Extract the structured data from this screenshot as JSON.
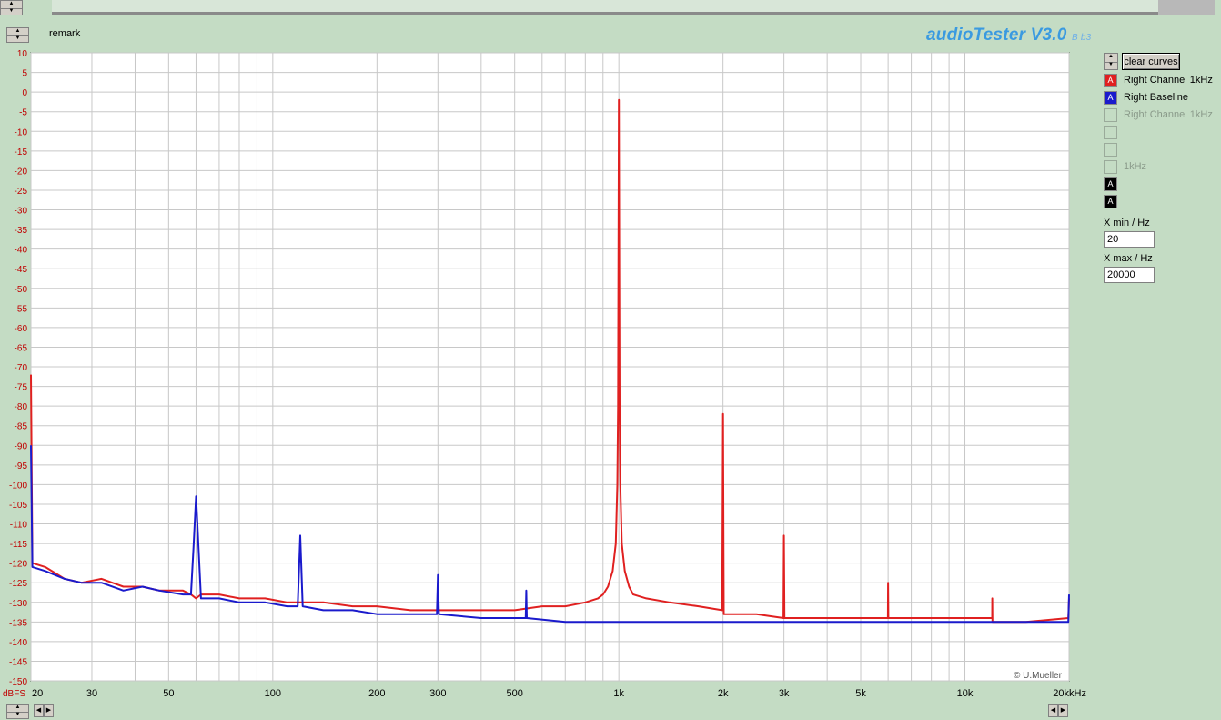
{
  "app": {
    "title": "audioTester V3.0",
    "version": "B b3",
    "remark_label": "remark",
    "copyright": "© U.Mueller"
  },
  "controls": {
    "clear_curves_label": "clear curves",
    "xmin_label": "X min / Hz",
    "xmin_value": "20",
    "xmax_label": "X max / Hz",
    "xmax_value": "20000"
  },
  "legend": [
    {
      "label": "Right Channel 1kHz",
      "marker": "A",
      "color": "#e02020",
      "active": true
    },
    {
      "label": "Right Baseline",
      "marker": "A",
      "color": "#1a1acc",
      "active": true
    },
    {
      "label": "Right Channel 1kHz",
      "marker": "",
      "color": "",
      "active": false
    },
    {
      "label": "",
      "marker": "",
      "color": "",
      "active": false
    },
    {
      "label": "",
      "marker": "",
      "color": "",
      "active": false
    },
    {
      "label": "1kHz",
      "marker": "",
      "color": "",
      "active": false
    },
    {
      "label": "",
      "marker": "A",
      "color": "#000000",
      "active": true
    },
    {
      "label": "",
      "marker": "A",
      "color": "#000000",
      "active": true
    }
  ],
  "chart_data": {
    "type": "line",
    "xscale": "log",
    "xlim": [
      20,
      20000
    ],
    "ylim": [
      -150,
      10
    ],
    "ylabel": "dBFS",
    "xunit": "kHz",
    "grid": true,
    "y_ticks": [
      10,
      5,
      0,
      -5,
      -10,
      -15,
      -20,
      -25,
      -30,
      -35,
      -40,
      -45,
      -50,
      -55,
      -60,
      -65,
      -70,
      -75,
      -80,
      -85,
      -90,
      -95,
      -100,
      -105,
      -110,
      -115,
      -120,
      -125,
      -130,
      -135,
      -140,
      -145,
      -150
    ],
    "x_ticks": [
      {
        "v": 20,
        "label": "20"
      },
      {
        "v": 30,
        "label": "30"
      },
      {
        "v": 50,
        "label": "50"
      },
      {
        "v": 100,
        "label": "100"
      },
      {
        "v": 200,
        "label": "200"
      },
      {
        "v": 300,
        "label": "300"
      },
      {
        "v": 500,
        "label": "500"
      },
      {
        "v": 1000,
        "label": "1k"
      },
      {
        "v": 2000,
        "label": "2k"
      },
      {
        "v": 3000,
        "label": "3k"
      },
      {
        "v": 5000,
        "label": "5k"
      },
      {
        "v": 10000,
        "label": "10k"
      },
      {
        "v": 20000,
        "label": "20k"
      }
    ],
    "series": [
      {
        "name": "Right Channel 1kHz",
        "color": "#e02020",
        "points": [
          [
            20,
            -72
          ],
          [
            20.2,
            -120
          ],
          [
            22,
            -121
          ],
          [
            25,
            -124
          ],
          [
            28,
            -125
          ],
          [
            32,
            -124
          ],
          [
            37,
            -126
          ],
          [
            42,
            -126
          ],
          [
            47,
            -127
          ],
          [
            55,
            -127
          ],
          [
            58,
            -128
          ],
          [
            60,
            -129
          ],
          [
            62,
            -128
          ],
          [
            70,
            -128
          ],
          [
            80,
            -129
          ],
          [
            95,
            -129
          ],
          [
            110,
            -130
          ],
          [
            120,
            -130
          ],
          [
            140,
            -130
          ],
          [
            170,
            -131
          ],
          [
            200,
            -131
          ],
          [
            250,
            -132
          ],
          [
            300,
            -132
          ],
          [
            400,
            -132
          ],
          [
            500,
            -132
          ],
          [
            600,
            -131
          ],
          [
            700,
            -131
          ],
          [
            800,
            -130
          ],
          [
            870,
            -129
          ],
          [
            900,
            -128
          ],
          [
            930,
            -126
          ],
          [
            960,
            -122
          ],
          [
            980,
            -115
          ],
          [
            990,
            -100
          ],
          [
            995,
            -80
          ],
          [
            1000,
            -2
          ],
          [
            1005,
            -80
          ],
          [
            1010,
            -100
          ],
          [
            1020,
            -115
          ],
          [
            1040,
            -122
          ],
          [
            1070,
            -126
          ],
          [
            1100,
            -128
          ],
          [
            1200,
            -129
          ],
          [
            1400,
            -130
          ],
          [
            1700,
            -131
          ],
          [
            1990,
            -132
          ],
          [
            2000,
            -82
          ],
          [
            2010,
            -133
          ],
          [
            2500,
            -133
          ],
          [
            2990,
            -134
          ],
          [
            3000,
            -113
          ],
          [
            3010,
            -134
          ],
          [
            4000,
            -134
          ],
          [
            5000,
            -134
          ],
          [
            5990,
            -134
          ],
          [
            6000,
            -125
          ],
          [
            6010,
            -134
          ],
          [
            8000,
            -134
          ],
          [
            10000,
            -134
          ],
          [
            11990,
            -134
          ],
          [
            12000,
            -129
          ],
          [
            12010,
            -135
          ],
          [
            15000,
            -135
          ],
          [
            19900,
            -134
          ],
          [
            20000,
            -129
          ]
        ]
      },
      {
        "name": "Right Baseline",
        "color": "#1a1acc",
        "points": [
          [
            20,
            -90
          ],
          [
            20.2,
            -121
          ],
          [
            22,
            -122
          ],
          [
            25,
            -124
          ],
          [
            28,
            -125
          ],
          [
            32,
            -125
          ],
          [
            37,
            -127
          ],
          [
            42,
            -126
          ],
          [
            47,
            -127
          ],
          [
            55,
            -128
          ],
          [
            58,
            -128
          ],
          [
            59,
            -116
          ],
          [
            60,
            -103
          ],
          [
            61,
            -116
          ],
          [
            62,
            -129
          ],
          [
            70,
            -129
          ],
          [
            80,
            -130
          ],
          [
            95,
            -130
          ],
          [
            110,
            -131
          ],
          [
            118,
            -131
          ],
          [
            120,
            -113
          ],
          [
            122,
            -131
          ],
          [
            140,
            -132
          ],
          [
            170,
            -132
          ],
          [
            200,
            -133
          ],
          [
            250,
            -133
          ],
          [
            298,
            -133
          ],
          [
            300,
            -123
          ],
          [
            302,
            -133
          ],
          [
            400,
            -134
          ],
          [
            500,
            -134
          ],
          [
            538,
            -134
          ],
          [
            540,
            -127
          ],
          [
            542,
            -134
          ],
          [
            700,
            -135
          ],
          [
            900,
            -135
          ],
          [
            1000,
            -135
          ],
          [
            1400,
            -135
          ],
          [
            2000,
            -135
          ],
          [
            3000,
            -135
          ],
          [
            5000,
            -135
          ],
          [
            8000,
            -135
          ],
          [
            12000,
            -135
          ],
          [
            16000,
            -135
          ],
          [
            19900,
            -135
          ],
          [
            20000,
            -128
          ]
        ]
      }
    ]
  }
}
